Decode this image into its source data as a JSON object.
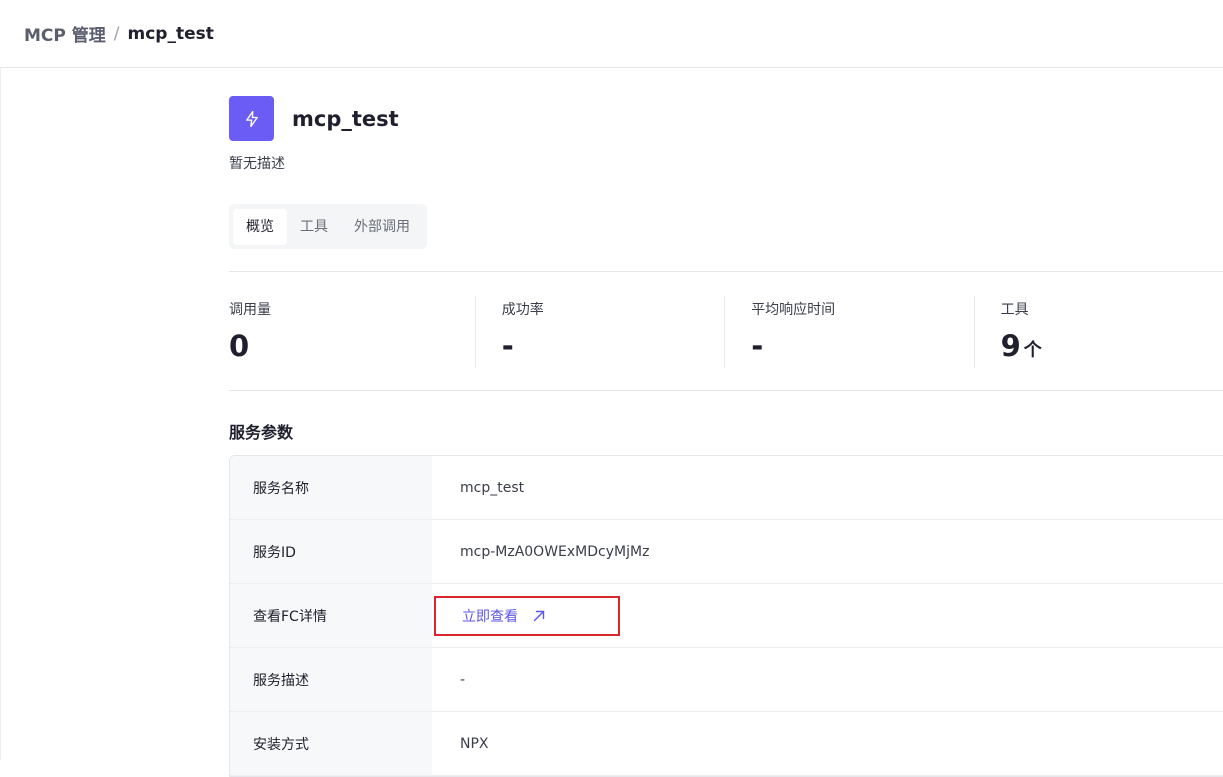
{
  "breadcrumb": {
    "parent": "MCP 管理",
    "separator": "/",
    "current": "mcp_test"
  },
  "app": {
    "title": "mcp_test",
    "description": "暂无描述",
    "icon": "lightning-icon",
    "accent_color": "#6b5cf6"
  },
  "tabs": [
    {
      "label": "概览",
      "active": true
    },
    {
      "label": "工具",
      "active": false
    },
    {
      "label": "外部调用",
      "active": false
    }
  ],
  "stats": [
    {
      "label": "调用量",
      "value": "0",
      "unit": ""
    },
    {
      "label": "成功率",
      "value": "-",
      "unit": ""
    },
    {
      "label": "平均响应时间",
      "value": "-",
      "unit": ""
    },
    {
      "label": "工具",
      "value": "9",
      "unit": "个"
    }
  ],
  "params": {
    "title": "服务参数",
    "rows": [
      {
        "key": "服务名称",
        "value": "mcp_test"
      },
      {
        "key": "服务ID",
        "value": "mcp-MzA0OWExMDcyMjMz"
      },
      {
        "key": "查看FC详情",
        "link_label": "立即查看"
      },
      {
        "key": "服务描述",
        "value": "-"
      },
      {
        "key": "安装方式",
        "value": "NPX"
      }
    ]
  },
  "colors": {
    "link": "#5b55e8",
    "highlight_border": "#d9262b"
  }
}
